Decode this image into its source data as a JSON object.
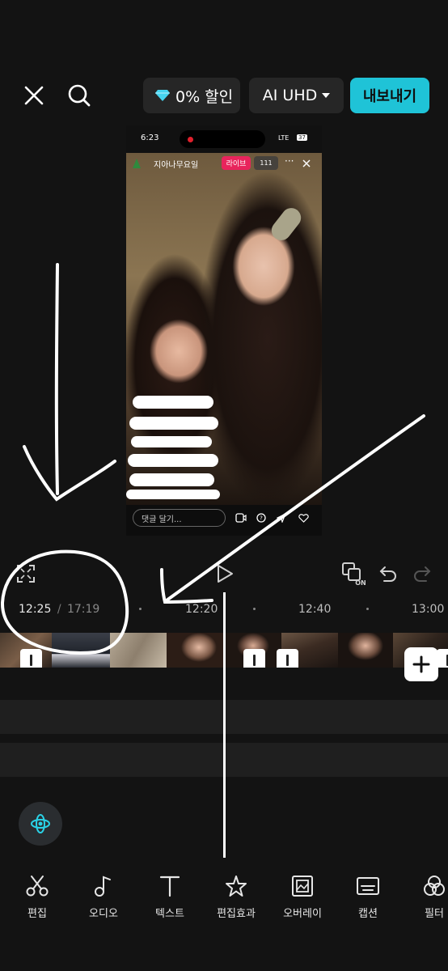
{
  "header": {
    "promo_label": "0% 할인",
    "quality_label": "AI UHD",
    "export_label": "내보내기"
  },
  "preview": {
    "status_time": "6:23",
    "status_net": "LTE",
    "status_battery": "37",
    "account_name": "지아나무요일",
    "live_badge": "라이브",
    "viewer_count": "111",
    "comment_placeholder": "댓글 달기..."
  },
  "timeline": {
    "current_time": "12:25",
    "separator": "/",
    "total_time": "17:19",
    "ticks": [
      "12:20",
      "12:40",
      "13:00"
    ]
  },
  "toolbar": {
    "items": [
      {
        "label": "편집",
        "icon": "scissors-icon"
      },
      {
        "label": "오디오",
        "icon": "music-note-icon"
      },
      {
        "label": "텍스트",
        "icon": "text-icon"
      },
      {
        "label": "편집효과",
        "icon": "sparkle-star-icon"
      },
      {
        "label": "오버레이",
        "icon": "overlay-icon"
      },
      {
        "label": "캡션",
        "icon": "caption-icon"
      },
      {
        "label": "필터",
        "icon": "filter-icon"
      }
    ]
  }
}
